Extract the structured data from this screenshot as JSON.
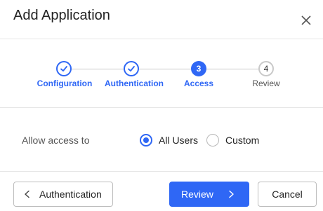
{
  "dialog": {
    "title": "Add Application",
    "close_icon": "close-icon"
  },
  "steps": [
    {
      "label": "Configuration",
      "state": "completed",
      "icon": "check-icon"
    },
    {
      "label": "Authentication",
      "state": "completed",
      "icon": "check-icon"
    },
    {
      "label": "Access",
      "state": "active",
      "number": "3"
    },
    {
      "label": "Review",
      "state": "pending",
      "number": "4"
    }
  ],
  "access": {
    "label": "Allow access to",
    "options": [
      {
        "label": "All Users",
        "selected": true
      },
      {
        "label": "Custom",
        "selected": false
      }
    ]
  },
  "footer": {
    "back_label": "Authentication",
    "back_icon": "chevron-left-icon",
    "review_label": "Review",
    "review_icon": "chevron-right-icon",
    "cancel_label": "Cancel"
  },
  "colors": {
    "accent": "#2f67f5",
    "border": "#e6e6e6",
    "inactive": "#c9c9c9"
  }
}
